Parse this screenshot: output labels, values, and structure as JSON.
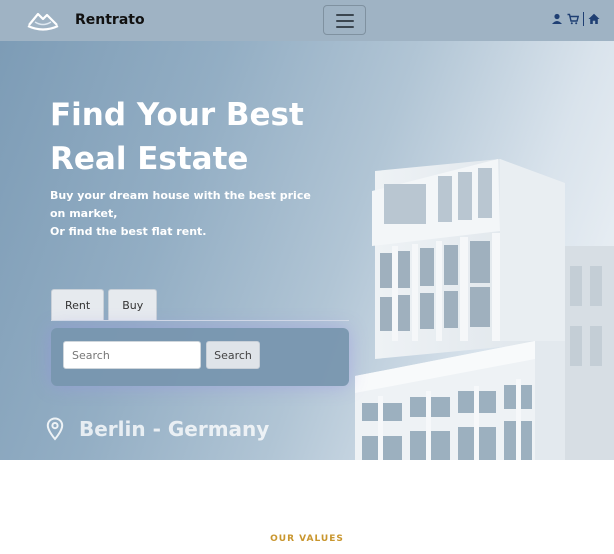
{
  "header": {
    "brand_name": "Rentrato",
    "icons": [
      "user-icon",
      "cart-icon",
      "home-icon"
    ],
    "bg_color": "#9fb3c4"
  },
  "hero": {
    "title": "Find Your Best Real Estate",
    "subtitle_lines": [
      "Buy your dream house with the best price on market,",
      "Or find the best flat rent."
    ],
    "tabs": [
      {
        "label": "Rent"
      },
      {
        "label": "Buy"
      }
    ],
    "search": {
      "placeholder": "Search",
      "button_label": "Search"
    },
    "location": "Berlin - Germany"
  },
  "values_section": {
    "label": "OUR VALUES",
    "accent_color": "#c9962e"
  }
}
